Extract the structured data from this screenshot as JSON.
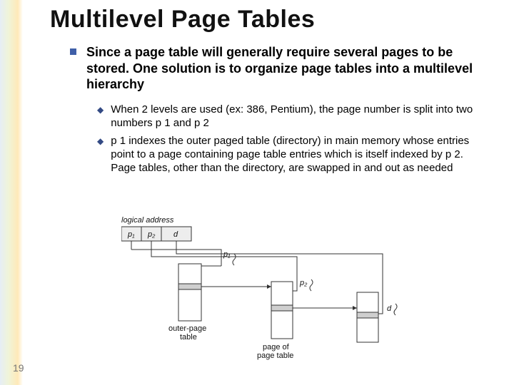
{
  "title": "Multilevel Page Tables",
  "main_bullet": "Since a page table will generally require several pages to be stored. One solution is to organize page tables into a multilevel hierarchy",
  "sub_bullets": [
    " When 2 levels are used (ex: 386, Pentium), the page number is split into two numbers p 1 and p 2",
    "p 1 indexes the outer paged table (directory) in main memory whose entries point to a page containing page table entries which is itself indexed by p 2. Page tables, other than the directory, are swapped in and out as needed"
  ],
  "page_number": "19",
  "diagram": {
    "logical_address_label": "logical address",
    "cells": {
      "p1": "p₁",
      "p2": "p₂",
      "d": "d"
    },
    "arrows": {
      "p1": "p₁",
      "p2": "p₂",
      "d": "d"
    },
    "outer_label": "outer-page\ntable",
    "page_label": "page of\npage table"
  }
}
